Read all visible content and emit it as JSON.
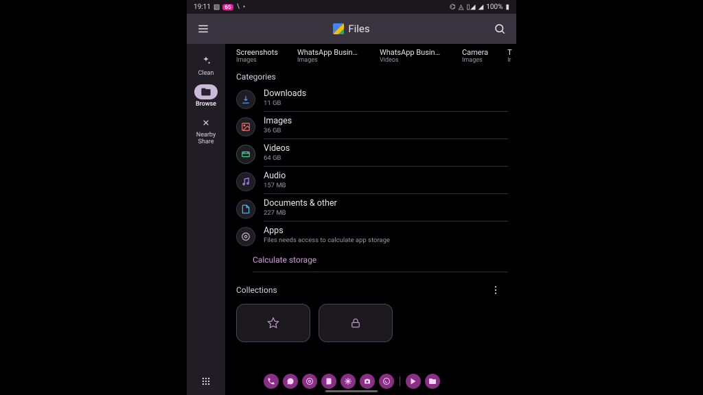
{
  "statusbar": {
    "time": "19:11",
    "badge": "65",
    "battery": "100%"
  },
  "appbar": {
    "title": "Files"
  },
  "sidenav": {
    "clean": "Clean",
    "browse": "Browse",
    "nearby": "Nearby\nShare"
  },
  "recent": [
    {
      "title": "Screenshots",
      "sub": "Images"
    },
    {
      "title": "WhatsApp Busines...",
      "sub": "Images"
    },
    {
      "title": "WhatsApp Busines...",
      "sub": "Videos"
    },
    {
      "title": "Camera",
      "sub": "Images"
    },
    {
      "title": "T",
      "sub": "Ir"
    }
  ],
  "sections": {
    "categories": "Categories",
    "collections": "Collections"
  },
  "categories": [
    {
      "name": "Downloads",
      "sub": "11 GB",
      "icon": "download",
      "color": "#4f9cff"
    },
    {
      "name": "Images",
      "sub": "36 GB",
      "icon": "image",
      "color": "#ff6d6d"
    },
    {
      "name": "Videos",
      "sub": "64 GB",
      "icon": "video",
      "color": "#3bd98c",
      "green": true
    },
    {
      "name": "Audio",
      "sub": "157 MB",
      "icon": "audio",
      "color": "#b388ff"
    },
    {
      "name": "Documents & other",
      "sub": "227 MB",
      "icon": "document",
      "color": "#4fc3f7"
    },
    {
      "name": "Apps",
      "sub": "Files needs access to calculate app storage",
      "icon": "apps",
      "color": "#bdbdbd"
    }
  ],
  "actions": {
    "calculate": "Calculate storage"
  },
  "collections": [
    {
      "id": "favorites",
      "icon": "star"
    },
    {
      "id": "safe",
      "icon": "lock"
    }
  ],
  "dock": {
    "icons": [
      "phone",
      "chat",
      "chrome",
      "note",
      "snow",
      "camera",
      "whatsapp"
    ],
    "right": [
      "play",
      "folder"
    ]
  }
}
